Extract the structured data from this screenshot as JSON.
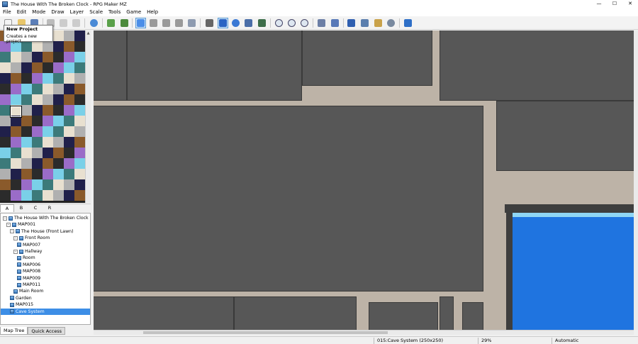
{
  "window": {
    "title": "The House With The Broken Clock - RPG Maker MZ",
    "controls": [
      "—",
      "☐",
      "✕"
    ]
  },
  "menu": [
    "File",
    "Edit",
    "Mode",
    "Draw",
    "Layer",
    "Scale",
    "Tools",
    "Game",
    "Help"
  ],
  "tooltip": {
    "title": "New Project",
    "description": "Creates a new project."
  },
  "tileset_tabs": [
    "A",
    "B",
    "C",
    "R"
  ],
  "tileset_selected_tab": "A",
  "map_tree": [
    {
      "label": "The House With The Broken Clock",
      "indent": 0,
      "expander": "⊟",
      "selected": false
    },
    {
      "label": "MAP001",
      "indent": 1,
      "expander": "⊟",
      "selected": false
    },
    {
      "label": "The House (Front Lawn)",
      "indent": 2,
      "expander": "⊟",
      "selected": false
    },
    {
      "label": "Front Room",
      "indent": 3,
      "expander": "⊟",
      "selected": false
    },
    {
      "label": "MAP007",
      "indent": 4,
      "expander": "",
      "selected": false
    },
    {
      "label": "Hallway",
      "indent": 3,
      "expander": "⊟",
      "selected": false
    },
    {
      "label": "Room",
      "indent": 4,
      "expander": "",
      "selected": false
    },
    {
      "label": "MAP006",
      "indent": 4,
      "expander": "",
      "selected": false
    },
    {
      "label": "MAP008",
      "indent": 4,
      "expander": "",
      "selected": false
    },
    {
      "label": "MAP009",
      "indent": 4,
      "expander": "",
      "selected": false
    },
    {
      "label": "MAP011",
      "indent": 4,
      "expander": "",
      "selected": false
    },
    {
      "label": "Main Room",
      "indent": 3,
      "expander": "",
      "selected": false
    },
    {
      "label": "Garden",
      "indent": 2,
      "expander": "",
      "selected": false
    },
    {
      "label": "MAP015",
      "indent": 2,
      "expander": "",
      "selected": false
    },
    {
      "label": "Cave System",
      "indent": 2,
      "expander": "",
      "selected": true
    }
  ],
  "bottom_tabs": [
    "Map Tree",
    "Quick Access"
  ],
  "status": {
    "map_info": "015:Cave System (250x250)",
    "zoom": "29%",
    "mode": "Automatic"
  },
  "colors": {
    "selection": "#3d8ee6",
    "cave_wall": "#575757",
    "cave_floor": "#bdb3a7",
    "water": "#1f74e0"
  }
}
